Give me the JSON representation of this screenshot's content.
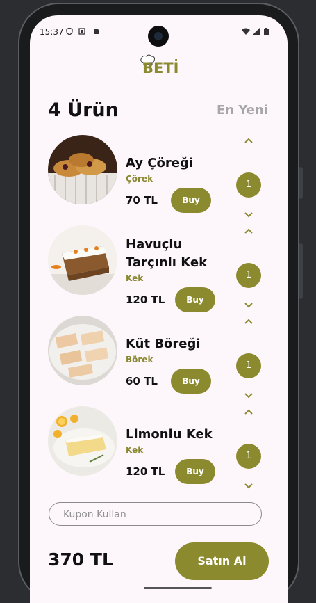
{
  "status_bar": {
    "time": "15:37"
  },
  "header": {
    "logo_text": "BETİ"
  },
  "list_header": {
    "count_label": "4 Ürün",
    "sort_label": "En Yeni"
  },
  "products": [
    {
      "name": "Ay Çöreği",
      "category": "Çörek",
      "price": "70 TL",
      "buy_label": "Buy",
      "quantity": "1"
    },
    {
      "name": "Havuçlu Tarçınlı Kek",
      "category": "Kek",
      "price": "120 TL",
      "buy_label": "Buy",
      "quantity": "1"
    },
    {
      "name": "Küt Böreği",
      "category": "Börek",
      "price": "60 TL",
      "buy_label": "Buy",
      "quantity": "1"
    },
    {
      "name": "Limonlu Kek",
      "category": "Kek",
      "price": "120 TL",
      "buy_label": "Buy",
      "quantity": "1"
    }
  ],
  "coupon": {
    "placeholder": "Kupon Kullan",
    "value": ""
  },
  "footer": {
    "total": "370 TL",
    "checkout_label": "Satın Al"
  },
  "colors": {
    "accent": "#8c8a2e",
    "background": "#fdf7fb",
    "muted": "#a7a7a7"
  }
}
